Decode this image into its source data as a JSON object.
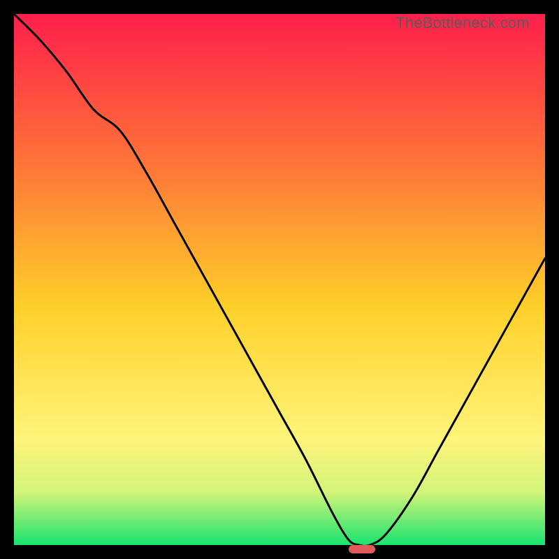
{
  "watermark": {
    "text": "TheBottleneck.com"
  },
  "colors": {
    "gradient_top": "#ff1f4b",
    "gradient_upper": "#ff6a3a",
    "gradient_mid": "#ffcf29",
    "gradient_low1": "#fff57a",
    "gradient_low2": "#d3f47a",
    "gradient_bottom": "#19e36e",
    "curve": "#000000",
    "marker": "#e05a5a",
    "frame": "#000000"
  },
  "chart_data": {
    "type": "line",
    "title": "",
    "xlabel": "",
    "ylabel": "",
    "xlim": [
      0,
      100
    ],
    "ylim": [
      0,
      100
    ],
    "x": [
      0,
      5,
      10,
      15,
      20,
      25,
      30,
      35,
      40,
      45,
      50,
      55,
      60,
      63,
      65,
      67,
      70,
      75,
      80,
      85,
      90,
      95,
      100
    ],
    "values": [
      100,
      95,
      89,
      82,
      78,
      70,
      61,
      52,
      43,
      34,
      25,
      16,
      6,
      1,
      0,
      0,
      2,
      9,
      18,
      27,
      36,
      45,
      54
    ],
    "optimum_x_range": [
      63,
      68
    ],
    "gradient_stops": [
      {
        "pos": 0.0,
        "hex": "#ff1f4b"
      },
      {
        "pos": 0.25,
        "hex": "#ff6a3a"
      },
      {
        "pos": 0.55,
        "hex": "#ffcf29"
      },
      {
        "pos": 0.8,
        "hex": "#fff57a"
      },
      {
        "pos": 0.9,
        "hex": "#d3f47a"
      },
      {
        "pos": 1.0,
        "hex": "#19e36e"
      }
    ]
  }
}
